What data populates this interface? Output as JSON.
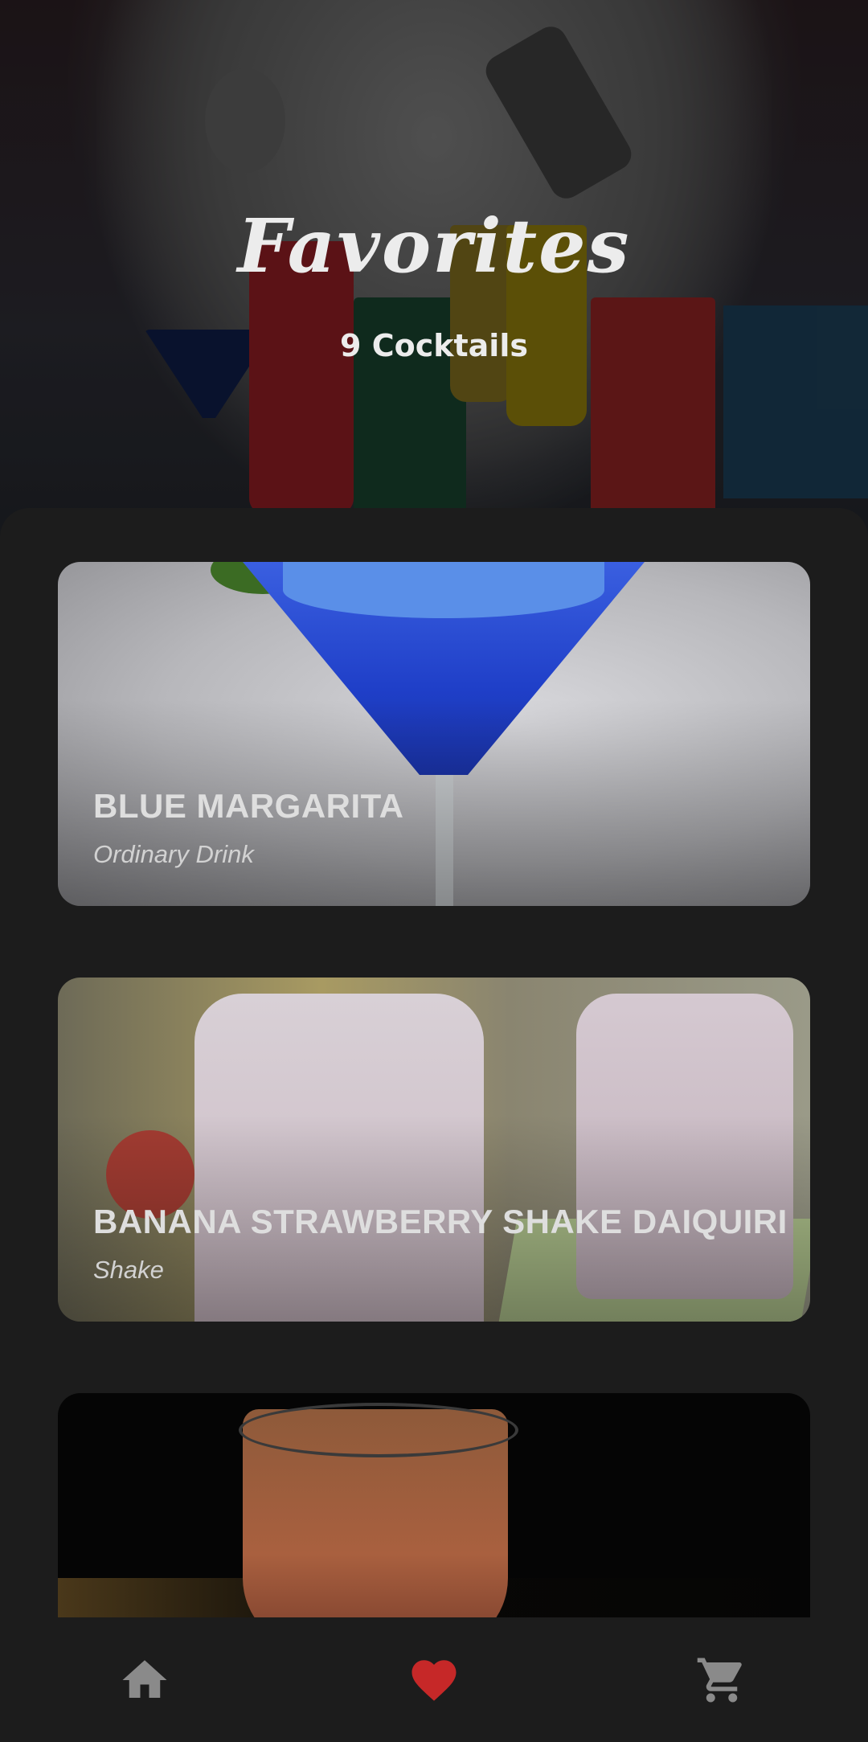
{
  "header": {
    "title": "Favorites",
    "subtitle": "9 Cocktails"
  },
  "favorites": [
    {
      "name": "BLUE MARGARITA",
      "category": "Ordinary Drink"
    },
    {
      "name": "BANANA STRAWBERRY SHAKE DAIQUIRI",
      "category": "Shake"
    },
    {
      "name": "",
      "category": ""
    }
  ],
  "bottom_nav": {
    "items": [
      {
        "icon": "home-icon",
        "active": false
      },
      {
        "icon": "heart-icon",
        "active": true
      },
      {
        "icon": "cart-icon",
        "active": false
      }
    ],
    "colors": {
      "active": "#c62828",
      "inactive": "#8a8a8a"
    }
  }
}
